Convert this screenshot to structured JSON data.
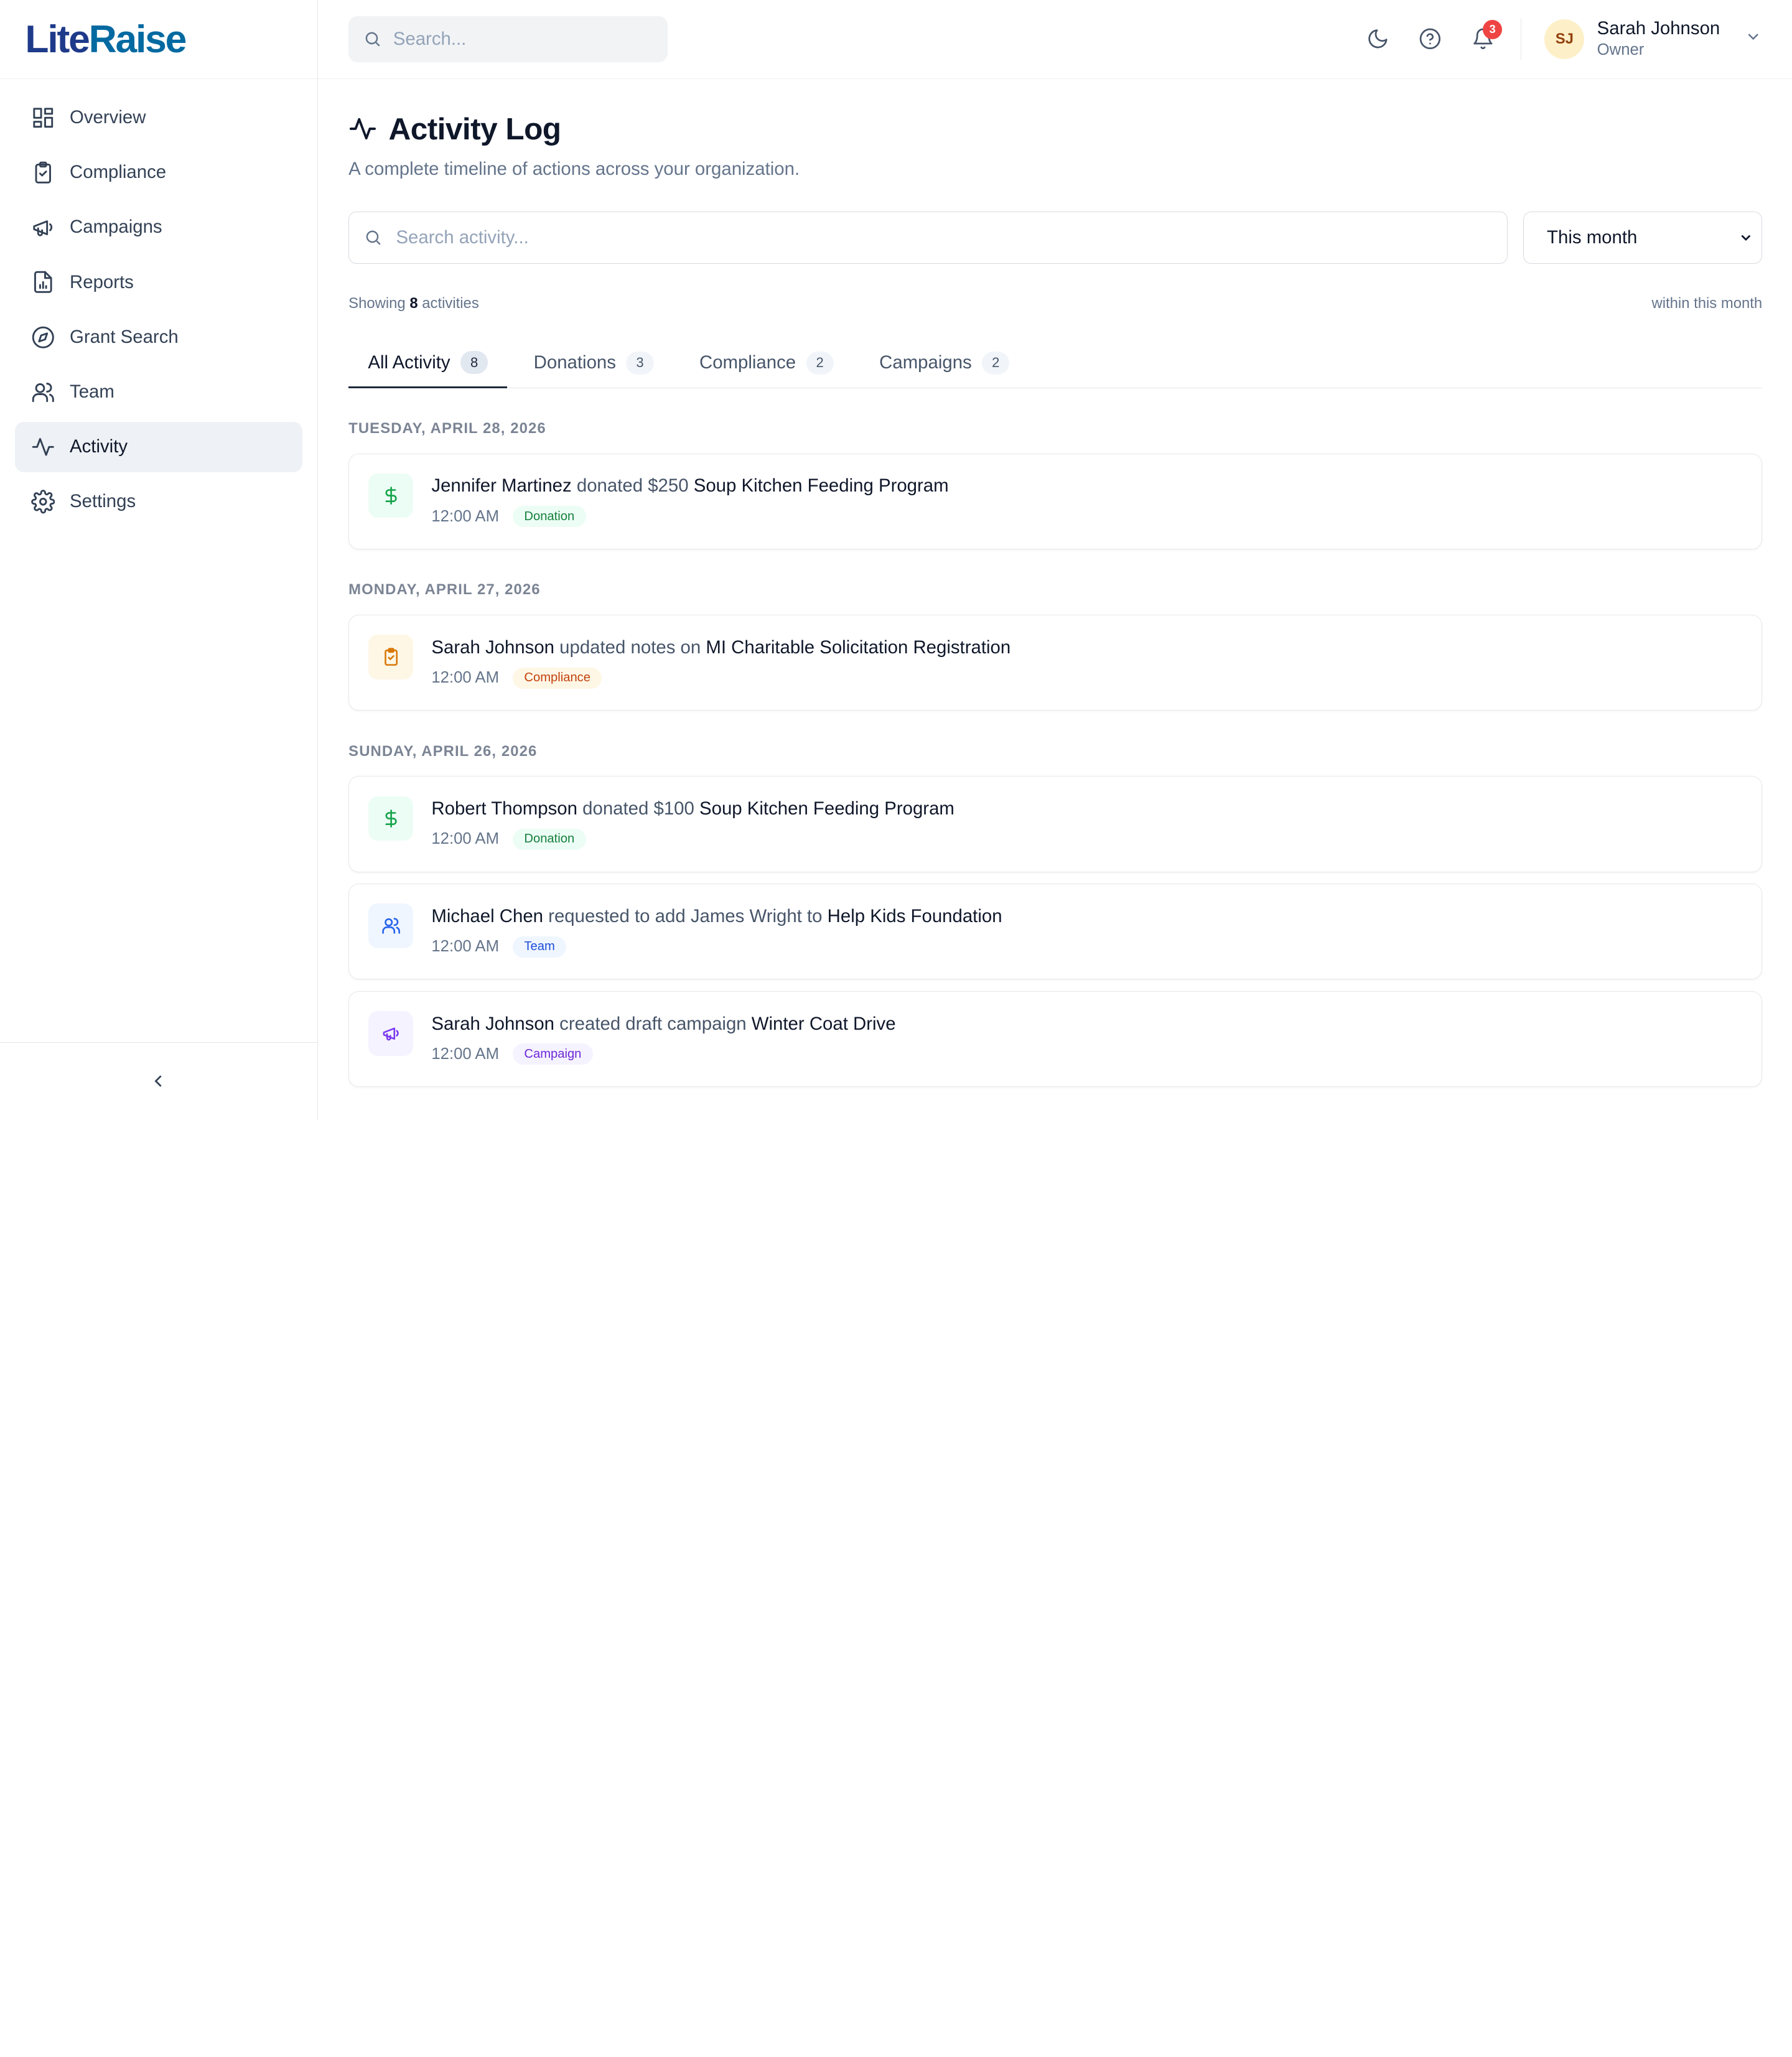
{
  "brand": {
    "name_part1": "Lite",
    "name_part2": "Raise"
  },
  "sidebar": {
    "items": [
      {
        "label": "Overview"
      },
      {
        "label": "Compliance"
      },
      {
        "label": "Campaigns"
      },
      {
        "label": "Reports"
      },
      {
        "label": "Grant Search"
      },
      {
        "label": "Team"
      },
      {
        "label": "Activity",
        "active": true
      },
      {
        "label": "Settings"
      }
    ]
  },
  "topbar": {
    "search_placeholder": "Search...",
    "notification_count": "3",
    "user": {
      "initials": "SJ",
      "name": "Sarah Johnson",
      "role": "Owner"
    }
  },
  "page": {
    "title": "Activity Log",
    "subtitle": "A complete timeline of actions across your organization.",
    "search_placeholder": "Search activity...",
    "period": "This month",
    "showing_prefix": "Showing",
    "showing_count": "8",
    "showing_suffix": "activities",
    "range_label": "within this month"
  },
  "tabs": [
    {
      "label": "All Activity",
      "count": "8",
      "active": true
    },
    {
      "label": "Donations",
      "count": "3"
    },
    {
      "label": "Compliance",
      "count": "2"
    },
    {
      "label": "Campaigns",
      "count": "2"
    }
  ],
  "days": [
    {
      "date": "TUESDAY, APRIL 28, 2026"
    },
    {
      "date": "MONDAY, APRIL 27, 2026"
    },
    {
      "date": "SUNDAY, APRIL 26, 2026"
    }
  ],
  "activities": [
    {
      "actor": "Jennifer Martinez",
      "action": "donated $250",
      "target": "Soup Kitchen Feeding Program",
      "time": "12:00 AM",
      "tag": "Donation",
      "icon": "dollar-icon"
    },
    {
      "actor": "Sarah Johnson",
      "action": "updated notes on",
      "target": "MI Charitable Solicitation Registration",
      "time": "12:00 AM",
      "tag": "Compliance",
      "icon": "clipboard-check-icon"
    },
    {
      "actor": "Robert Thompson",
      "action": "donated $100",
      "target": "Soup Kitchen Feeding Program",
      "time": "12:00 AM",
      "tag": "Donation",
      "icon": "dollar-icon"
    },
    {
      "actor": "Michael Chen",
      "action": "requested to add James Wright to",
      "target": "Help Kids Foundation",
      "time": "12:00 AM",
      "tag": "Team",
      "icon": "users-icon"
    },
    {
      "actor": "Sarah Johnson",
      "action": "created draft campaign",
      "target": "Winter Coat Drive",
      "time": "12:00 AM",
      "tag": "Campaign",
      "icon": "megaphone-icon"
    }
  ],
  "colors": {
    "donation": "#16a34a",
    "compliance": "#d97706",
    "team": "#2563eb",
    "campaign": "#7c3aed",
    "brand": "#1e3a8a"
  }
}
